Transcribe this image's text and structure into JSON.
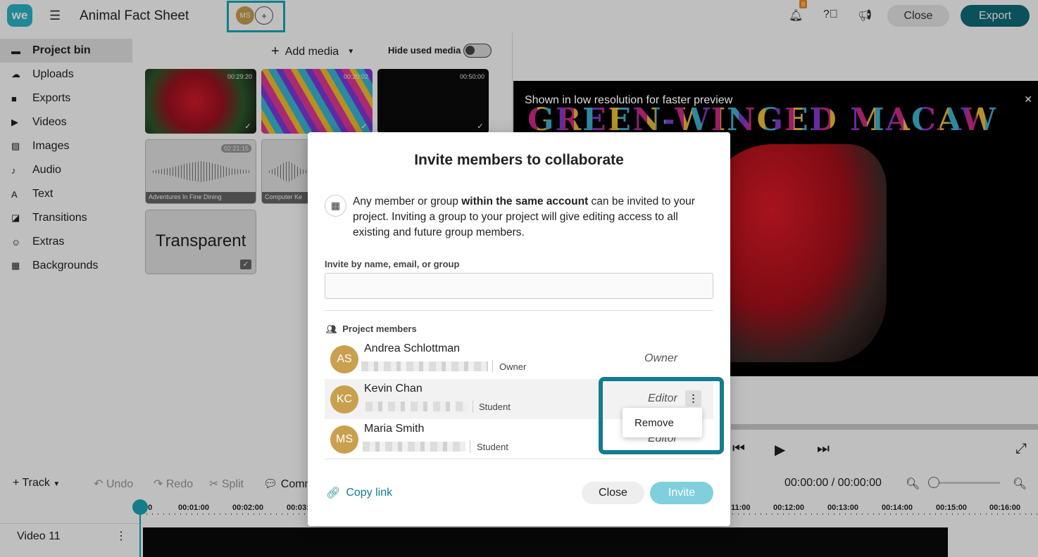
{
  "app": {
    "logo": "we",
    "title": "Animal Fact Sheet",
    "collab_avatar": "MS",
    "notifications_badge": "8",
    "close_label": "Close",
    "export_label": "Export"
  },
  "sidebar": {
    "items": [
      {
        "label": "Project bin",
        "icon": "bin-icon"
      },
      {
        "label": "Uploads",
        "icon": "cloud-upload-icon"
      },
      {
        "label": "Exports",
        "icon": "export-icon"
      },
      {
        "label": "Videos",
        "icon": "video-icon"
      },
      {
        "label": "Images",
        "icon": "image-icon"
      },
      {
        "label": "Audio",
        "icon": "music-icon"
      },
      {
        "label": "Text",
        "icon": "text-icon"
      },
      {
        "label": "Transitions",
        "icon": "transition-icon"
      },
      {
        "label": "Extras",
        "icon": "smiley-icon"
      },
      {
        "label": "Backgrounds",
        "icon": "background-icon"
      }
    ]
  },
  "media_bin": {
    "add_media": "Add media",
    "hide_used": "Hide used media",
    "items": [
      {
        "duration": "00:29:20",
        "caption": ""
      },
      {
        "duration": "00:20:02",
        "caption": ""
      },
      {
        "duration": "00:50:00",
        "caption": ""
      },
      {
        "duration": "02:21:15",
        "caption": "Adventures In Fine Dining"
      },
      {
        "duration": "",
        "caption": "Computer Ke"
      },
      {
        "duration": "",
        "caption": "Transparent"
      }
    ]
  },
  "preview": {
    "note": "Shown in low resolution for faster preview",
    "overlay_title": "GREEN-WINGED MACAW"
  },
  "timeline": {
    "track_btn": "Track",
    "undo": "Undo",
    "redo": "Redo",
    "split": "Split",
    "comment": "Comm",
    "timecode": "00:00:00 / 00:00:00",
    "ruler": [
      "00",
      "00:01:00",
      "00:02:00",
      "00:03:",
      "11:00",
      "00:12:00",
      "00:13:00",
      "00:14:00",
      "00:15:00",
      "00:16:00"
    ],
    "track_label": "Video 11"
  },
  "modal": {
    "title": "Invite members to collaborate",
    "info_pre": "Any member or group ",
    "info_bold": "within the same account",
    "info_post": " can be invited to your project. Inviting a group to your project will give editing access to all existing and future group members.",
    "invite_label": "Invite by name, email, or group",
    "invite_value": "",
    "members_heading": "Project members",
    "members": [
      {
        "initials": "AS",
        "name": "Andrea Schlottman",
        "role": "Owner",
        "permission": "Owner"
      },
      {
        "initials": "KC",
        "name": "Kevin Chan",
        "role": "Student",
        "permission": "Editor"
      },
      {
        "initials": "MS",
        "name": "Maria Smith",
        "role": "Student",
        "permission": "Editor"
      }
    ],
    "menu_item": "Remove",
    "copy_link": "Copy link",
    "close_label": "Close",
    "invite_label_btn": "Invite"
  },
  "colors": {
    "accent": "#1aa7b8",
    "export": "#0f6d7a",
    "avatar": "#c9a04e",
    "invite_disabled": "#7fd0dc"
  }
}
